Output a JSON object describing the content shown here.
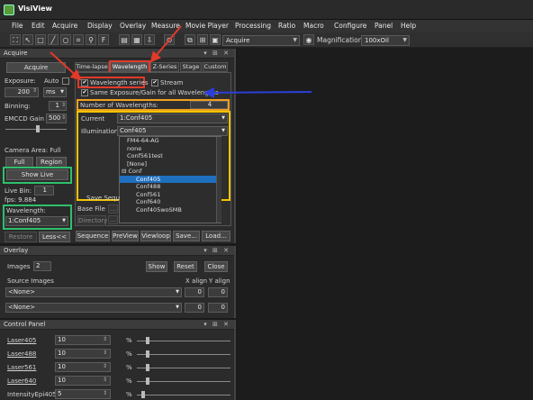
{
  "window": {
    "title": "VisiView"
  },
  "menubar": {
    "items": [
      "File",
      "Edit",
      "Acquire",
      "Display",
      "Overlay",
      "Measure",
      "Movie Player",
      "Processing",
      "Ratio",
      "Macro",
      "Configure",
      "Panel",
      "Help"
    ]
  },
  "toolbar": {
    "camera_value": "Acquire",
    "magnification_label": "Magnification",
    "magnification_value": "100xOil"
  },
  "acquire": {
    "header": "Acquire",
    "acquire_button": "Acquire",
    "exposure_label": "Exposure:",
    "auto_label": "Auto",
    "exposure_value": "200",
    "exposure_unit": "ms",
    "binning_label": "Binning:",
    "binning_value": "1",
    "emccd_label": "EMCCD Gain",
    "emccd_value": "500",
    "camera_area_label": "Camera Area: Full",
    "full_button": "Full",
    "region_button": "Region",
    "show_live_button": "Show Live",
    "live_bin_label": "Live Bin:",
    "live_bin_value": "1",
    "fps_label": "fps: 9.884",
    "wavelength_label": "Wavelength:",
    "wavelength_value": "1:Conf405",
    "restore_button": "Restore",
    "less_button": "Less<<"
  },
  "tabs": [
    "Time-lapse",
    "Wavelength",
    "Z-Series",
    "Stage",
    "Custom"
  ],
  "wavelength_tab": {
    "wavelength_series": "Wavelength series",
    "stream": "Stream",
    "same_exposure": "Same Exposure/Gain for all Wavelengths",
    "num_wavelengths_label": "Number of Wavelengths:",
    "num_wavelengths_value": "4",
    "current_label": "Current",
    "current_value": "1:Conf405",
    "illumination_label": "Illumination",
    "illumination_value": "Conf405",
    "save_label": "Save Sequ",
    "base_file_label": "Base File",
    "directory_button": "Directory",
    "dropdown_items": [
      "FM4-64-AG",
      "none",
      "Conf561test",
      "[None]",
      "Conf",
      "Conf405",
      "Conf488",
      "Conf561",
      "Conf640",
      "Conf405woSMB"
    ],
    "selected_item": "Conf405"
  },
  "bottom_buttons": [
    "Sequence",
    "PreView",
    "Viewloop",
    "Save...",
    "Load..."
  ],
  "overlay": {
    "header": "Overlay",
    "images_label": "Images",
    "images_value": "2",
    "show_button": "Show",
    "reset_button": "Reset",
    "close_button": "Close",
    "source_images_label": "Source Images",
    "x_align_label": "X align",
    "y_align_label": "Y align",
    "rows": [
      {
        "source": "<None>",
        "x": "0",
        "y": "0"
      },
      {
        "source": "<None>",
        "x": "0",
        "y": "0"
      }
    ]
  },
  "control_panel": {
    "header": "Control Panel",
    "rows": [
      {
        "label": "Laser405",
        "value": "10",
        "unit": "%",
        "level": 0.1
      },
      {
        "label": "Laser488",
        "value": "10",
        "unit": "%",
        "level": 0.1
      },
      {
        "label": "Laser561",
        "value": "10",
        "unit": "%",
        "level": 0.1
      },
      {
        "label": "Laser640",
        "value": "10",
        "unit": "%",
        "level": 0.1
      },
      {
        "label": "IntensityEpi405",
        "value": "5",
        "unit": "%",
        "level": 0.05
      }
    ]
  },
  "colors": {
    "annotation_red": "#e23a2a",
    "annotation_orange": "#f0a020",
    "annotation_yellow": "#f5c400",
    "annotation_green": "#2ec06b",
    "annotation_blue": "#2a3fd8",
    "selection": "#1f6fbf"
  }
}
